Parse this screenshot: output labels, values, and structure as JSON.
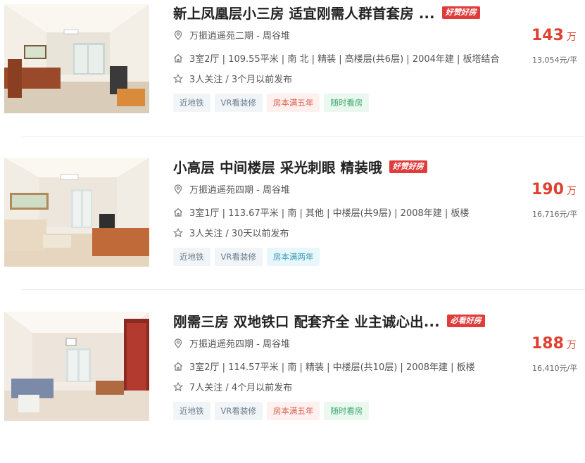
{
  "listings": [
    {
      "title": "新上凤凰层小三房 适宜刚需人群首套房 ...",
      "badge": "好赞好房",
      "location": "万振逍遥苑二期 - 周谷堆",
      "specs": "3室2厅 | 109.55平米 | 南 北 | 精装 | 高楼层(共6层) | 2004年建 | 板塔结合",
      "follow": "3人关注 / 3个月以前发布",
      "price_total": "143",
      "price_unit": "万",
      "unit_price": "13,054元/平",
      "tags": [
        {
          "label": "近地铁",
          "style": "gray"
        },
        {
          "label": "VR看装修",
          "style": "gray"
        },
        {
          "label": "房本满五年",
          "style": "red"
        },
        {
          "label": "随时看房",
          "style": "green"
        }
      ]
    },
    {
      "title": "小高层 中间楼层 采光刺眼 精装哦",
      "badge": "好赞好房",
      "location": "万振逍遥苑四期 - 周谷堆",
      "specs": "3室1厅 | 113.67平米 | 南 | 其他 | 中楼层(共9层) | 2008年建 | 板楼",
      "follow": "3人关注 / 30天以前发布",
      "price_total": "190",
      "price_unit": "万",
      "unit_price": "16,716元/平",
      "tags": [
        {
          "label": "近地铁",
          "style": "gray"
        },
        {
          "label": "VR看装修",
          "style": "gray"
        },
        {
          "label": "房本满两年",
          "style": "cyan"
        }
      ]
    },
    {
      "title": "刚需三房 双地铁口 配套齐全 业主诚心出...",
      "badge": "必看好房",
      "location": "万振逍遥苑四期 - 周谷堆",
      "specs": "3室2厅 | 114.57平米 | 南 | 精装 | 中楼层(共10层) | 2008年建 | 板楼",
      "follow": "7人关注 / 4个月以前发布",
      "price_total": "188",
      "price_unit": "万",
      "unit_price": "16,410元/平",
      "tags": [
        {
          "label": "近地铁",
          "style": "gray"
        },
        {
          "label": "VR看装修",
          "style": "gray"
        },
        {
          "label": "房本满五年",
          "style": "red"
        },
        {
          "label": "随时看房",
          "style": "green"
        }
      ]
    }
  ],
  "icons": {
    "location": "location-pin-icon",
    "house": "house-icon",
    "star": "star-icon"
  },
  "colors": {
    "price": "#e0402f",
    "badge": "#e03c3c"
  }
}
